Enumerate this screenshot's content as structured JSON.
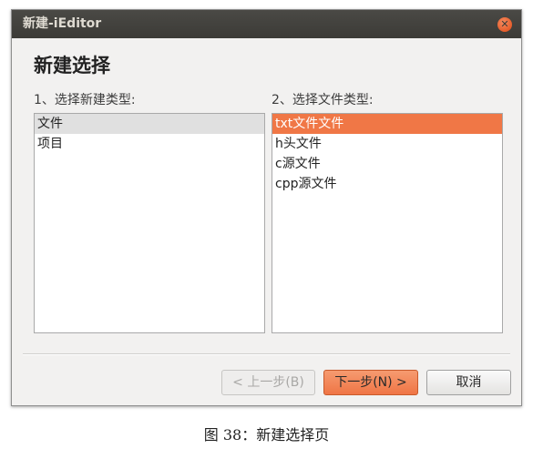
{
  "window": {
    "title": "新建-iEditor",
    "close_glyph": "✕"
  },
  "heading": "新建选择",
  "left_panel": {
    "label": "1、选择新建类型:",
    "items": [
      "文件",
      "项目"
    ],
    "selected": "文件"
  },
  "right_panel": {
    "label": "2、选择文件类型:",
    "items": [
      "txt文件文件",
      "h头文件",
      "c源文件",
      "cpp源文件"
    ],
    "selected": "txt文件文件"
  },
  "buttons": {
    "prev_label": "< 上一步(B)",
    "next_label": "下一步(N) >",
    "cancel_label": "取消"
  },
  "caption": "图 38：新建选择页",
  "colors": {
    "accent": "#f07746",
    "titlebar": "#3c3b37",
    "window_bg": "#f2f1f0"
  },
  "icons": {
    "close": "close-icon"
  }
}
